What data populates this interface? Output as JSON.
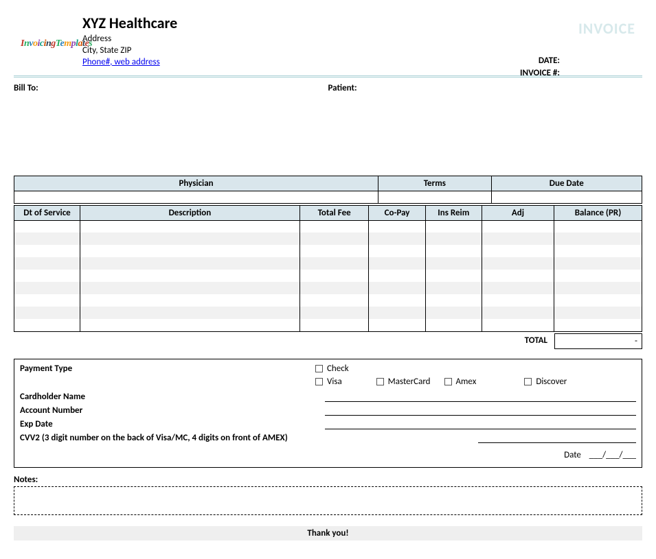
{
  "header": {
    "logo_text": "InvoicingTemplates",
    "company_name": "XYZ Healthcare",
    "address_line1": "Address",
    "address_line2": "City, State ZIP",
    "contact_link": "Phone#, web address",
    "invoice_title": "INVOICE",
    "date_label": "DATE:",
    "invoice_no_label": "INVOICE #:"
  },
  "parties": {
    "bill_to_label": "Bill To:",
    "patient_label": "Patient:"
  },
  "tbl1": {
    "physician_label": "Physician",
    "terms_label": "Terms",
    "due_date_label": "Due Date",
    "physician": "",
    "terms": "",
    "due_date": ""
  },
  "tbl2": {
    "headers": {
      "dt": "Dt of Service",
      "desc": "Description",
      "fee": "Total Fee",
      "copay": "Co-Pay",
      "ins": "Ins Reim",
      "adj": "Adj",
      "bal": "Balance (PR)"
    },
    "rows": [
      {
        "dt": "",
        "desc": "",
        "fee": "",
        "copay": "",
        "ins": "",
        "adj": "",
        "bal": ""
      },
      {
        "dt": "",
        "desc": "",
        "fee": "",
        "copay": "",
        "ins": "",
        "adj": "",
        "bal": ""
      },
      {
        "dt": "",
        "desc": "",
        "fee": "",
        "copay": "",
        "ins": "",
        "adj": "",
        "bal": ""
      },
      {
        "dt": "",
        "desc": "",
        "fee": "",
        "copay": "",
        "ins": "",
        "adj": "",
        "bal": ""
      },
      {
        "dt": "",
        "desc": "",
        "fee": "",
        "copay": "",
        "ins": "",
        "adj": "",
        "bal": ""
      },
      {
        "dt": "",
        "desc": "",
        "fee": "",
        "copay": "",
        "ins": "",
        "adj": "",
        "bal": ""
      },
      {
        "dt": "",
        "desc": "",
        "fee": "",
        "copay": "",
        "ins": "",
        "adj": "",
        "bal": ""
      },
      {
        "dt": "",
        "desc": "",
        "fee": "",
        "copay": "",
        "ins": "",
        "adj": "",
        "bal": ""
      },
      {
        "dt": "",
        "desc": "",
        "fee": "",
        "copay": "",
        "ins": "",
        "adj": "",
        "bal": ""
      }
    ],
    "total_label": "TOTAL",
    "total_value": "-"
  },
  "payment": {
    "type_label": "Payment Type",
    "check": "Check",
    "visa": "Visa",
    "mastercard": "MasterCard",
    "amex": "Amex",
    "discover": "Discover",
    "cardholder_label": "Cardholder Name",
    "account_label": "Account Number",
    "exp_label": "Exp Date",
    "cvv_label": "CVV2 (3 digit number on the back of Visa/MC, 4 digits on front of AMEX)",
    "date_label": "Date",
    "date_placeholder": "___/___/___"
  },
  "notes": {
    "label": "Notes:"
  },
  "footer": {
    "thanks": "Thank you!"
  }
}
